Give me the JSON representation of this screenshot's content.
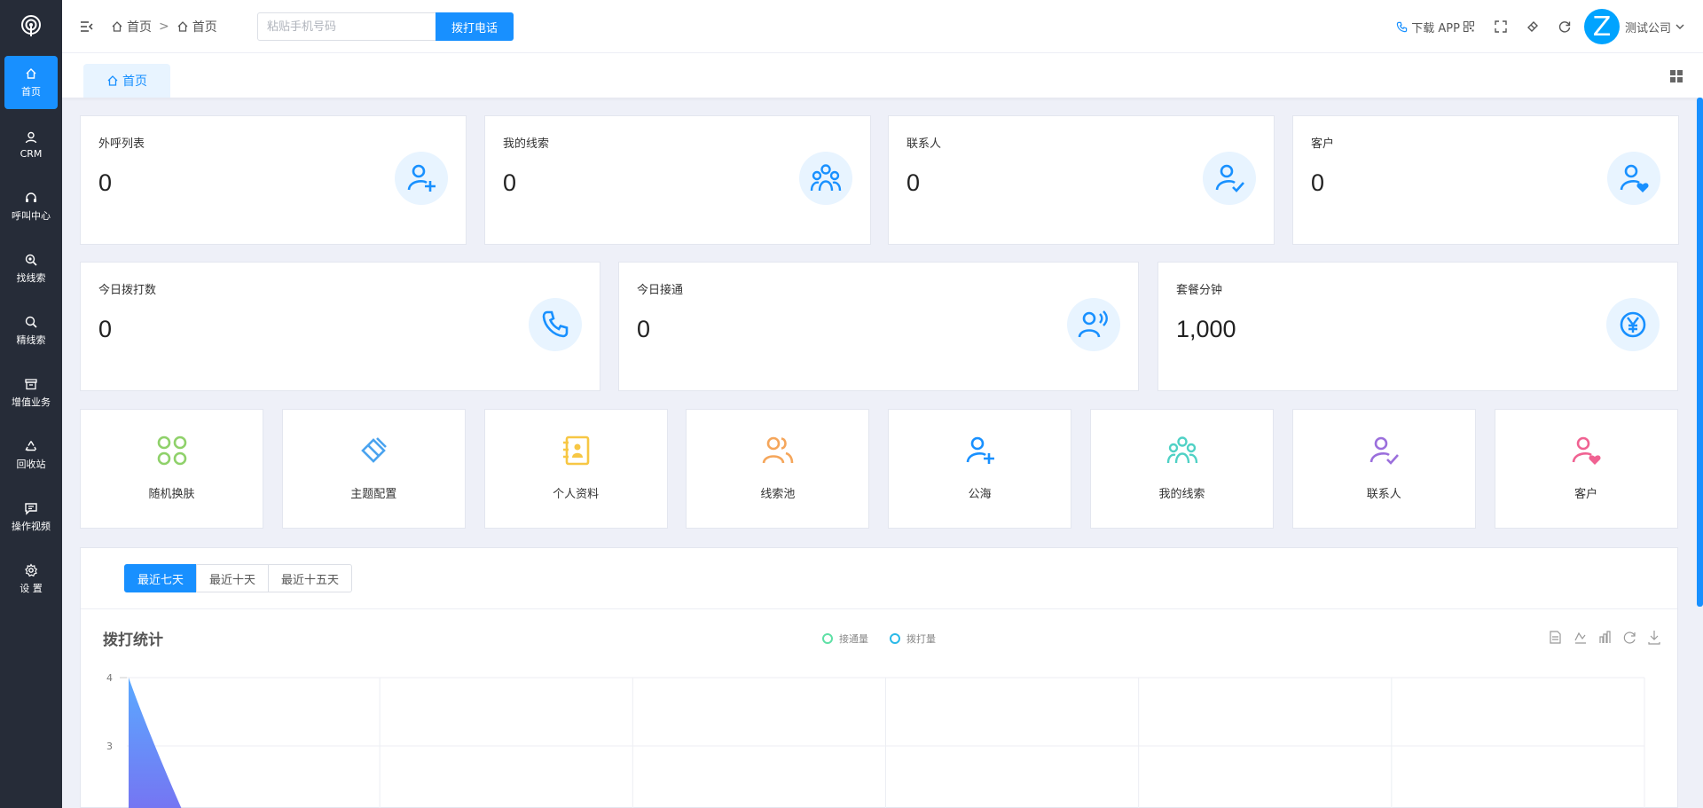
{
  "sidebar": {
    "items": [
      {
        "label": "首页",
        "icon": "home-icon",
        "active": true
      },
      {
        "label": "CRM",
        "icon": "user-icon"
      },
      {
        "label": "呼叫中心",
        "icon": "headset-icon"
      },
      {
        "label": "找线索",
        "icon": "search-plus-icon"
      },
      {
        "label": "精线索",
        "icon": "search-icon"
      },
      {
        "label": "增值业务",
        "icon": "archive-icon"
      },
      {
        "label": "回收站",
        "icon": "recycle-icon"
      },
      {
        "label": "操作视频",
        "icon": "message-icon"
      },
      {
        "label": "设 置",
        "icon": "gear-icon"
      }
    ]
  },
  "header": {
    "breadcrumb": [
      "首页",
      "首页"
    ],
    "breadcrumb_sep": ">",
    "phone_placeholder": "粘贴手机号码",
    "dial_label": "拨打电话",
    "download_label": "下载 APP",
    "avatar_letter": "Z",
    "company": "测试公司"
  },
  "tabs": {
    "home": "首页"
  },
  "stats_row1": [
    {
      "title": "外呼列表",
      "value": "0",
      "icon": "user-plus-icon"
    },
    {
      "title": "我的线索",
      "value": "0",
      "icon": "users-icon"
    },
    {
      "title": "联系人",
      "value": "0",
      "icon": "user-check-icon"
    },
    {
      "title": "客户",
      "value": "0",
      "icon": "user-heart-icon"
    }
  ],
  "stats_row2": [
    {
      "title": "今日拨打数",
      "value": "0",
      "icon": "phone-icon"
    },
    {
      "title": "今日接通",
      "value": "0",
      "icon": "user-voice-icon"
    },
    {
      "title": "套餐分钟",
      "value": "1,000",
      "icon": "yen-icon"
    }
  ],
  "quick": [
    {
      "label": "随机换肤",
      "icon": "clover-icon",
      "color": "#8fd16a"
    },
    {
      "label": "主题配置",
      "icon": "brush-icon",
      "color": "#4aa3ef"
    },
    {
      "label": "个人资料",
      "icon": "contact-book-icon",
      "color": "#f7c744"
    },
    {
      "label": "线索池",
      "icon": "users-pool-icon",
      "color": "#f5a65b"
    },
    {
      "label": "公海",
      "icon": "user-plus-icon",
      "color": "#1890ff"
    },
    {
      "label": "我的线索",
      "icon": "users-icon",
      "color": "#4fd1c5"
    },
    {
      "label": "联系人",
      "icon": "user-check-icon",
      "color": "#9b6fdc"
    },
    {
      "label": "客户",
      "icon": "user-heart-icon",
      "color": "#f06292"
    }
  ],
  "range_tabs": [
    "最近七天",
    "最近十天",
    "最近十五天"
  ],
  "chart_data": {
    "type": "area",
    "title": "拨打统计",
    "legend": [
      {
        "name": "接通量",
        "color": "#5fe0a6"
      },
      {
        "name": "拨打量",
        "color": "#2ab9e8"
      }
    ],
    "legend_position": "top-center",
    "ylim": [
      2,
      4
    ],
    "yticks": [
      "4",
      "3"
    ],
    "grid": true,
    "series": [
      {
        "name": "拨打量",
        "points": [
          [
            0,
            4
          ],
          [
            0.25,
            2
          ]
        ]
      }
    ],
    "toolbox": [
      "data-view-icon",
      "line-icon",
      "bar-icon",
      "restore-icon",
      "download-icon"
    ]
  }
}
